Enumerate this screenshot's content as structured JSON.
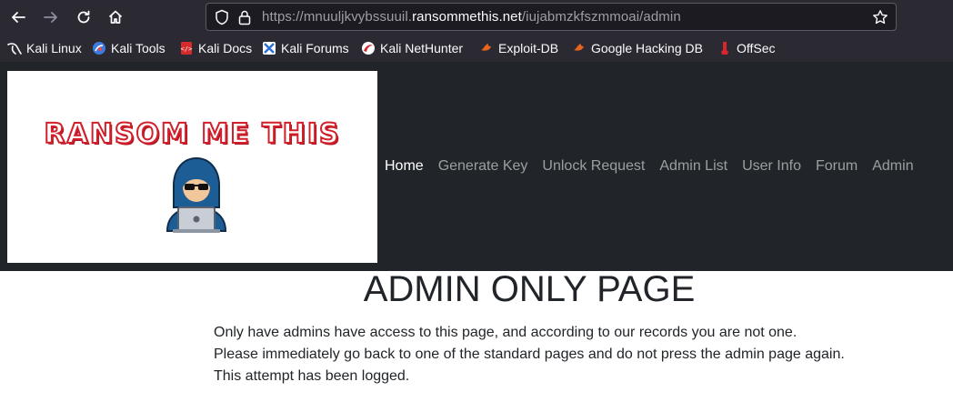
{
  "browser": {
    "url_prefix": "https://mnuuljkvybssuuil.",
    "url_host": "ransommethis.net",
    "url_path": "/iujabmzkfszmmoai/admin",
    "bookmarks": [
      {
        "label": "Kali Linux",
        "icon": "kali-dragon-icon"
      },
      {
        "label": "Kali Tools",
        "icon": "kali-tools-icon"
      },
      {
        "label": "Kali Docs",
        "icon": "kali-docs-icon"
      },
      {
        "label": "Kali Forums",
        "icon": "kali-forums-icon"
      },
      {
        "label": "Kali NetHunter",
        "icon": "nethunter-icon"
      },
      {
        "label": "Exploit-DB",
        "icon": "exploit-db-icon"
      },
      {
        "label": "Google Hacking DB",
        "icon": "ghdb-icon"
      },
      {
        "label": "OffSec",
        "icon": "offsec-icon"
      }
    ]
  },
  "site": {
    "logo_text": "RANSOM ME THIS",
    "nav": [
      {
        "label": "Home",
        "active": true
      },
      {
        "label": "Generate Key"
      },
      {
        "label": "Unlock Request"
      },
      {
        "label": "Admin List"
      },
      {
        "label": "User Info"
      },
      {
        "label": "Forum"
      },
      {
        "label": "Admin"
      }
    ]
  },
  "main": {
    "title": "ADMIN ONLY PAGE",
    "lines": [
      "Only have admins have access to this page, and according to our records you are not one.",
      "Please immediately go back to one of the standard pages and do not press the admin page again.",
      "This attempt has been logged."
    ]
  },
  "colors": {
    "chrome_bg": "#2b2a33",
    "header_bg": "#212529",
    "logo_red": "#d1202b"
  }
}
